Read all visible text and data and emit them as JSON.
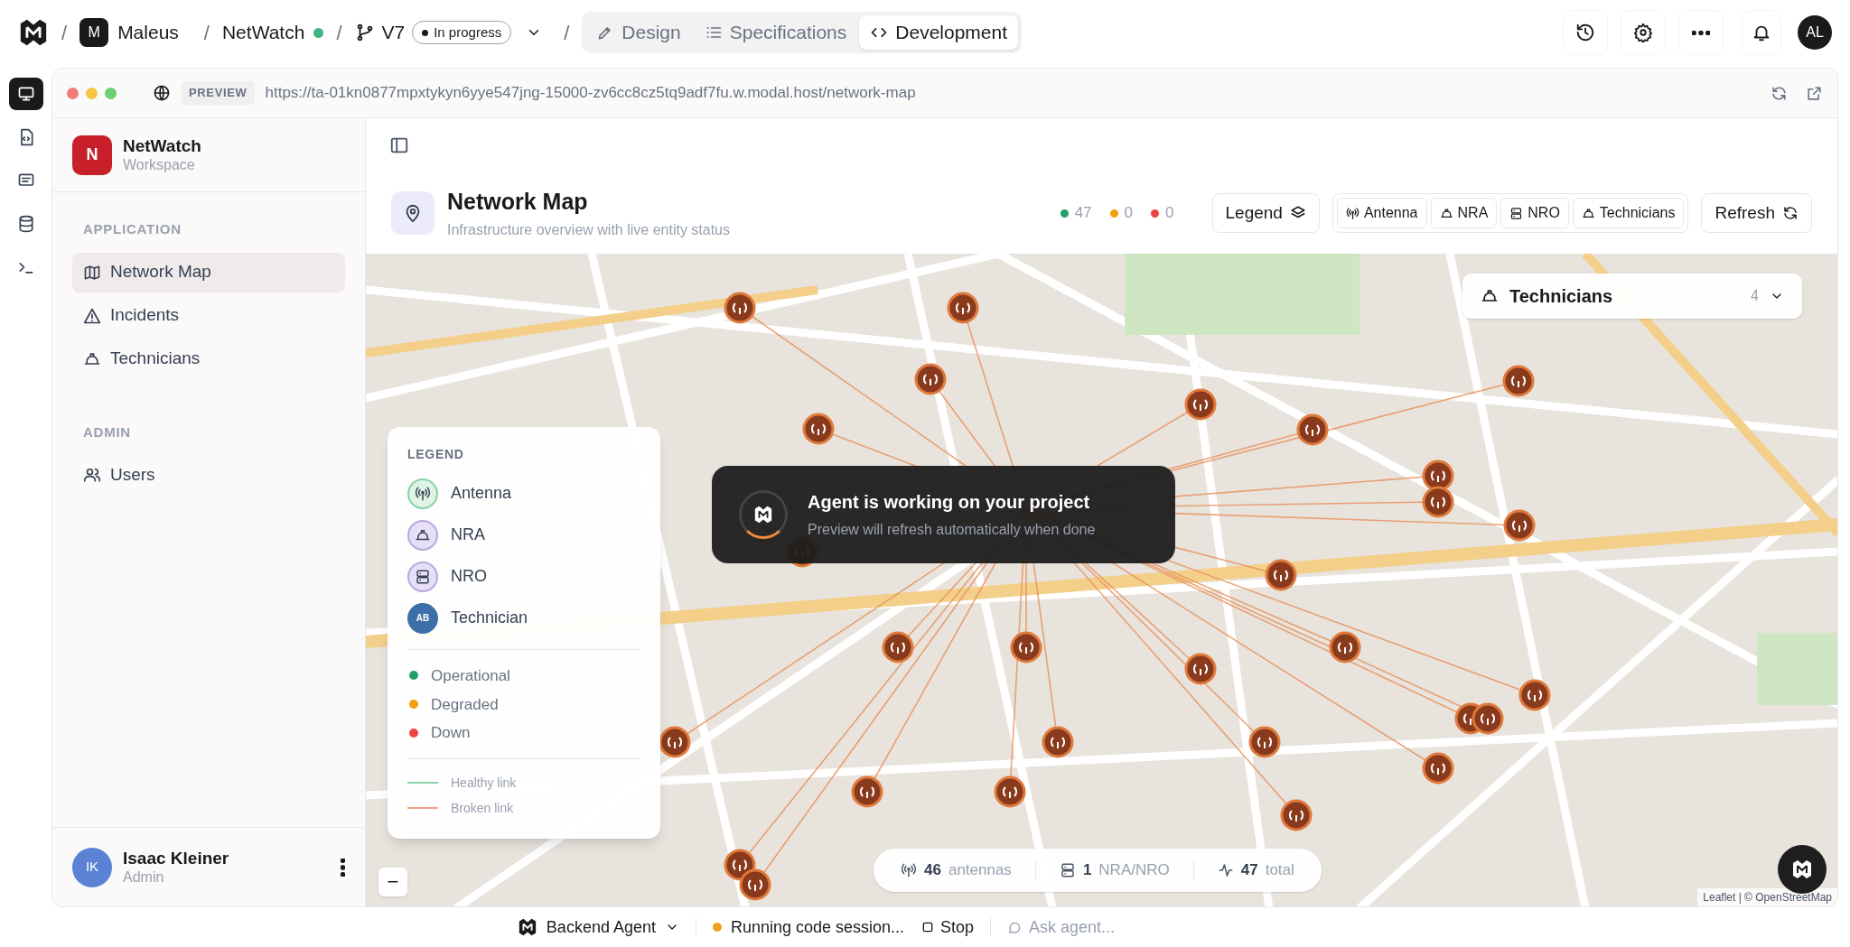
{
  "top_bar": {
    "separator": "/",
    "workspace": {
      "letter": "M",
      "name": "Maleus"
    },
    "project": {
      "name": "NetWatch",
      "color": "#3fb57f"
    },
    "branch": {
      "name": "V7",
      "status": "In progress"
    },
    "mode_tabs": [
      {
        "label": "Design",
        "selected": false
      },
      {
        "label": "Specifications",
        "selected": false
      },
      {
        "label": "Development",
        "selected": true
      }
    ],
    "avatar": "AL"
  },
  "left_rail": [
    {
      "selected": true
    },
    {
      "selected": false
    },
    {
      "selected": false
    },
    {
      "selected": false
    },
    {
      "selected": false
    }
  ],
  "browser": {
    "badge": "PREVIEW",
    "url": "https://ta-01kn0877mpxtykyn6yye547jng-15000-zv6cc8cz5tq9adf7fu.w.modal.host/network-map"
  },
  "sidebar": {
    "brand": {
      "letter": "N",
      "name": "NetWatch",
      "subtitle": "Workspace"
    },
    "sections": [
      {
        "title": "APPLICATION",
        "items": [
          {
            "label": "Network Map",
            "selected": true
          },
          {
            "label": "Incidents",
            "selected": false
          },
          {
            "label": "Technicians",
            "selected": false
          }
        ]
      },
      {
        "title": "ADMIN",
        "items": [
          {
            "label": "Users",
            "selected": false
          }
        ]
      }
    ],
    "user": {
      "initials": "IK",
      "name": "Isaac Kleiner",
      "role": "Admin"
    }
  },
  "header": {
    "title": "Network Map",
    "subtitle": "Infrastructure overview with live entity status",
    "counts": [
      {
        "value": "47",
        "color": "#22a06b"
      },
      {
        "value": "0",
        "color": "#f59e0b"
      },
      {
        "value": "0",
        "color": "#ef4444"
      }
    ],
    "legend_button": "Legend",
    "filters": [
      "Antenna",
      "NRA",
      "NRO",
      "Technicians"
    ],
    "refresh": "Refresh"
  },
  "map": {
    "technicians_dropdown": {
      "label": "Technicians",
      "count": "4"
    },
    "legend": {
      "title": "LEGEND",
      "entities": [
        {
          "kind": "antenna",
          "label": "Antenna"
        },
        {
          "kind": "nra",
          "label": "NRA"
        },
        {
          "kind": "nro",
          "label": "NRO"
        },
        {
          "kind": "technician",
          "label": "Technician",
          "initials": "AB"
        }
      ],
      "statuses": [
        {
          "label": "Operational",
          "color": "#22a06b"
        },
        {
          "label": "Degraded",
          "color": "#f59e0b"
        },
        {
          "label": "Down",
          "color": "#ef4444"
        }
      ],
      "links": [
        {
          "label": "Healthy link",
          "color": "#86d3a5"
        },
        {
          "label": "Broken link",
          "color": "#f0a08a"
        }
      ]
    },
    "stats": [
      {
        "value": "46",
        "label": "antennas"
      },
      {
        "value": "1",
        "label": "NRA/NRO"
      },
      {
        "value": "47",
        "label": "total"
      }
    ],
    "zoom_out": "−",
    "attribution": "Leaflet | © OpenStreetMap"
  },
  "overlay": {
    "title": "Agent is working on your project",
    "subtitle": "Preview will refresh automatically when done"
  },
  "bottom_bar": {
    "agent": "Backend Agent",
    "status": "Running code session...",
    "stop": "Stop",
    "ask_placeholder": "Ask agent..."
  }
}
